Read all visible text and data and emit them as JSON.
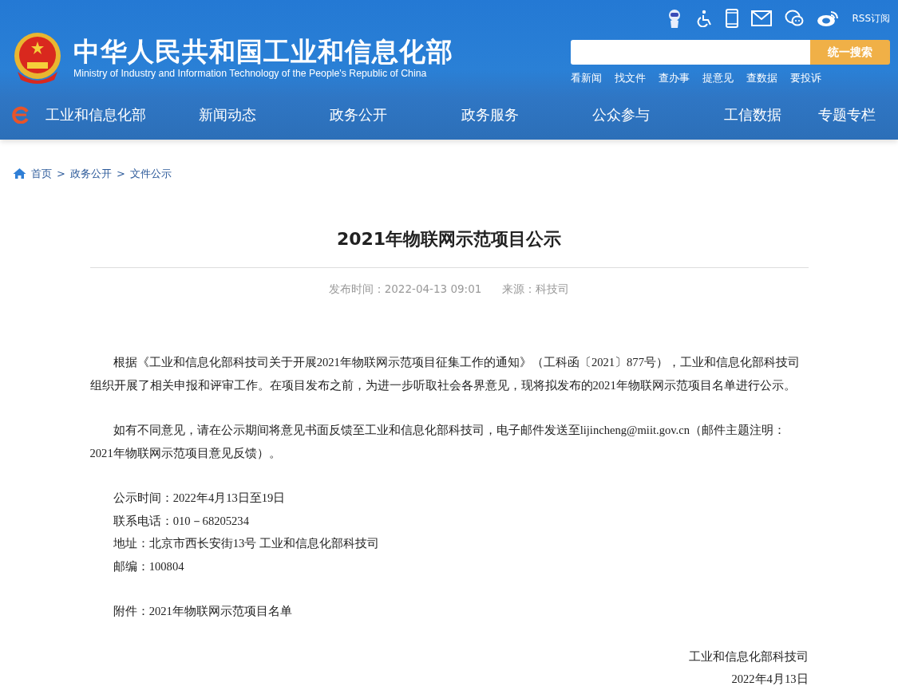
{
  "header": {
    "title": "中华人民共和国工业和信息化部",
    "subtitle": "Ministry of Industry and Information Technology of the People's Republic of China",
    "rss": "RSS订阅",
    "search": {
      "button": "统一搜索"
    },
    "quick_links": [
      "看新闻",
      "找文件",
      "查办事",
      "提意见",
      "查数据",
      "要投诉"
    ],
    "nav": [
      "工业和信息化部",
      "新闻动态",
      "政务公开",
      "政务服务",
      "公众参与",
      "工信数据",
      "专题专栏"
    ]
  },
  "breadcrumb": {
    "items": [
      "首页",
      "政务公开",
      "文件公示"
    ],
    "separators": [
      ">",
      ">"
    ]
  },
  "article": {
    "title": "2021年物联网示范项目公示",
    "meta": [
      "发布时间：2022-04-13 09:01",
      "来源：科技司"
    ],
    "body": [
      {
        "kind": "paragraph",
        "lines": [
          "根据《工业和信息化部科技司关于开展2021年物联网示范项目征集工作的通知》（工科函〔2021〕877号），工业和信息化部科技司组织开展了相关申报和评审工作。在项目发布之前，为进一步听取社会各界意见，现将拟发布的2021年物联网示范项目名单进行公示。"
        ]
      },
      {
        "kind": "paragraph",
        "lines": [
          "如有不同意见，请在公示期间将意见书面反馈至工业和信息化部科技司，电子邮件发送至lijincheng@miit.gov.cn（邮件主题注明：2021年物联网示范项目意见反馈）。"
        ]
      },
      {
        "kind": "lines",
        "lines": [
          "公示时间：2022年4月13日至19日",
          "联系电话：010－68205234",
          "地址：北京市西长安街13号 工业和信息化部科技司",
          "邮编：100804"
        ]
      },
      {
        "kind": "lines",
        "lines": [
          "附件：2021年物联网示范项目名单"
        ]
      },
      {
        "kind": "signature",
        "lines": [
          "工业和信息化部科技司",
          "2022年4月13日"
        ]
      }
    ]
  }
}
